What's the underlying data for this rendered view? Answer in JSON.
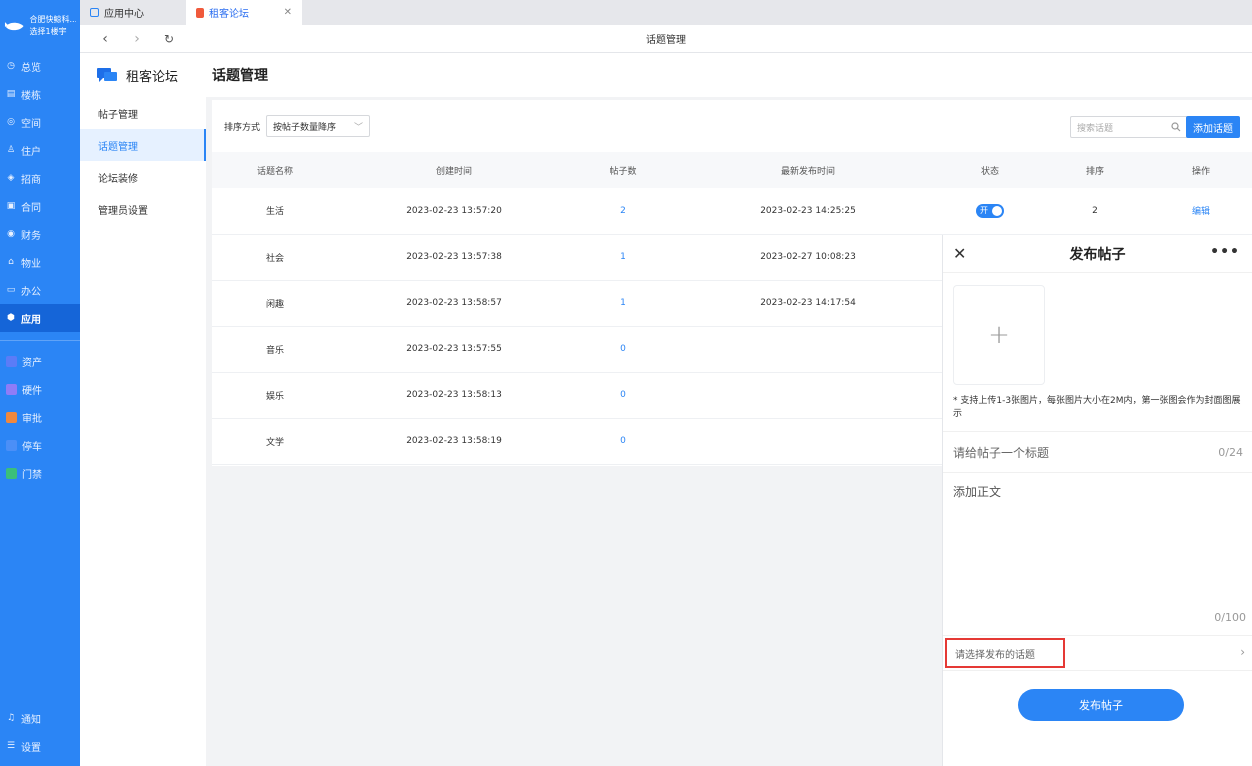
{
  "app": {
    "company": "合肥快鲸科...",
    "building": "选择1楼宇",
    "nav": [
      {
        "label": "总览",
        "icon": "dashboard-icon"
      },
      {
        "label": "楼栋",
        "icon": "building-icon"
      },
      {
        "label": "空间",
        "icon": "space-icon"
      },
      {
        "label": "住户",
        "icon": "resident-icon"
      },
      {
        "label": "招商",
        "icon": "investment-icon"
      },
      {
        "label": "合同",
        "icon": "contract-icon"
      },
      {
        "label": "财务",
        "icon": "finance-icon"
      },
      {
        "label": "物业",
        "icon": "property-icon"
      },
      {
        "label": "办公",
        "icon": "office-icon"
      },
      {
        "label": "应用",
        "icon": "app-icon"
      }
    ],
    "plugins": [
      {
        "label": "资产",
        "color": "#5b7cf7"
      },
      {
        "label": "硬件",
        "color": "#8f7cf7"
      },
      {
        "label": "审批",
        "color": "#f0883e"
      },
      {
        "label": "停车",
        "color": "#4b8ff7"
      },
      {
        "label": "门禁",
        "color": "#3bbf7a"
      }
    ],
    "bottom": [
      {
        "label": "通知",
        "icon": "bell-icon"
      },
      {
        "label": "设置",
        "icon": "menu-icon"
      }
    ]
  },
  "tabs": [
    {
      "label": "应用中心"
    },
    {
      "label": "租客论坛"
    }
  ],
  "toolbar": {
    "page_title": "话题管理"
  },
  "forum": {
    "title": "租客论坛",
    "menu": [
      "帖子管理",
      "话题管理",
      "论坛装修",
      "管理员设置"
    ]
  },
  "main": {
    "title": "话题管理",
    "sort_label": "排序方式",
    "sort_value": "按帖子数量降序",
    "search_placeholder": "搜索话题",
    "add_label": "添加话题",
    "columns": [
      "话题名称",
      "创建时间",
      "帖子数",
      "最新发布时间",
      "状态",
      "排序",
      "操作"
    ],
    "rows": [
      {
        "name": "生活",
        "created": "2023-02-23 13:57:20",
        "posts": "2",
        "latest": "2023-02-23 14:25:25",
        "status": "开",
        "order": "2",
        "op": "编辑"
      },
      {
        "name": "社会",
        "created": "2023-02-23 13:57:38",
        "posts": "1",
        "latest": "2023-02-27 10:08:23",
        "status": "",
        "order": "",
        "op": ""
      },
      {
        "name": "闲趣",
        "created": "2023-02-23 13:58:57",
        "posts": "1",
        "latest": "2023-02-23 14:17:54",
        "status": "",
        "order": "",
        "op": ""
      },
      {
        "name": "音乐",
        "created": "2023-02-23 13:57:55",
        "posts": "0",
        "latest": "",
        "status": "",
        "order": "",
        "op": ""
      },
      {
        "name": "娱乐",
        "created": "2023-02-23 13:58:13",
        "posts": "0",
        "latest": "",
        "status": "",
        "order": "",
        "op": ""
      },
      {
        "name": "文学",
        "created": "2023-02-23 13:58:19",
        "posts": "0",
        "latest": "",
        "status": "",
        "order": "",
        "op": ""
      }
    ]
  },
  "panel": {
    "title": "发布帖子",
    "upload_tip": "* 支持上传1-3张图片，每张图片大小在2M内，第一张图会作为封面图展示",
    "title_placeholder": "请给帖子一个标题",
    "title_count": "0/24",
    "body_placeholder": "添加正文",
    "body_count": "0/100",
    "topic_placeholder": "请选择发布的话题",
    "submit": "发布帖子"
  }
}
